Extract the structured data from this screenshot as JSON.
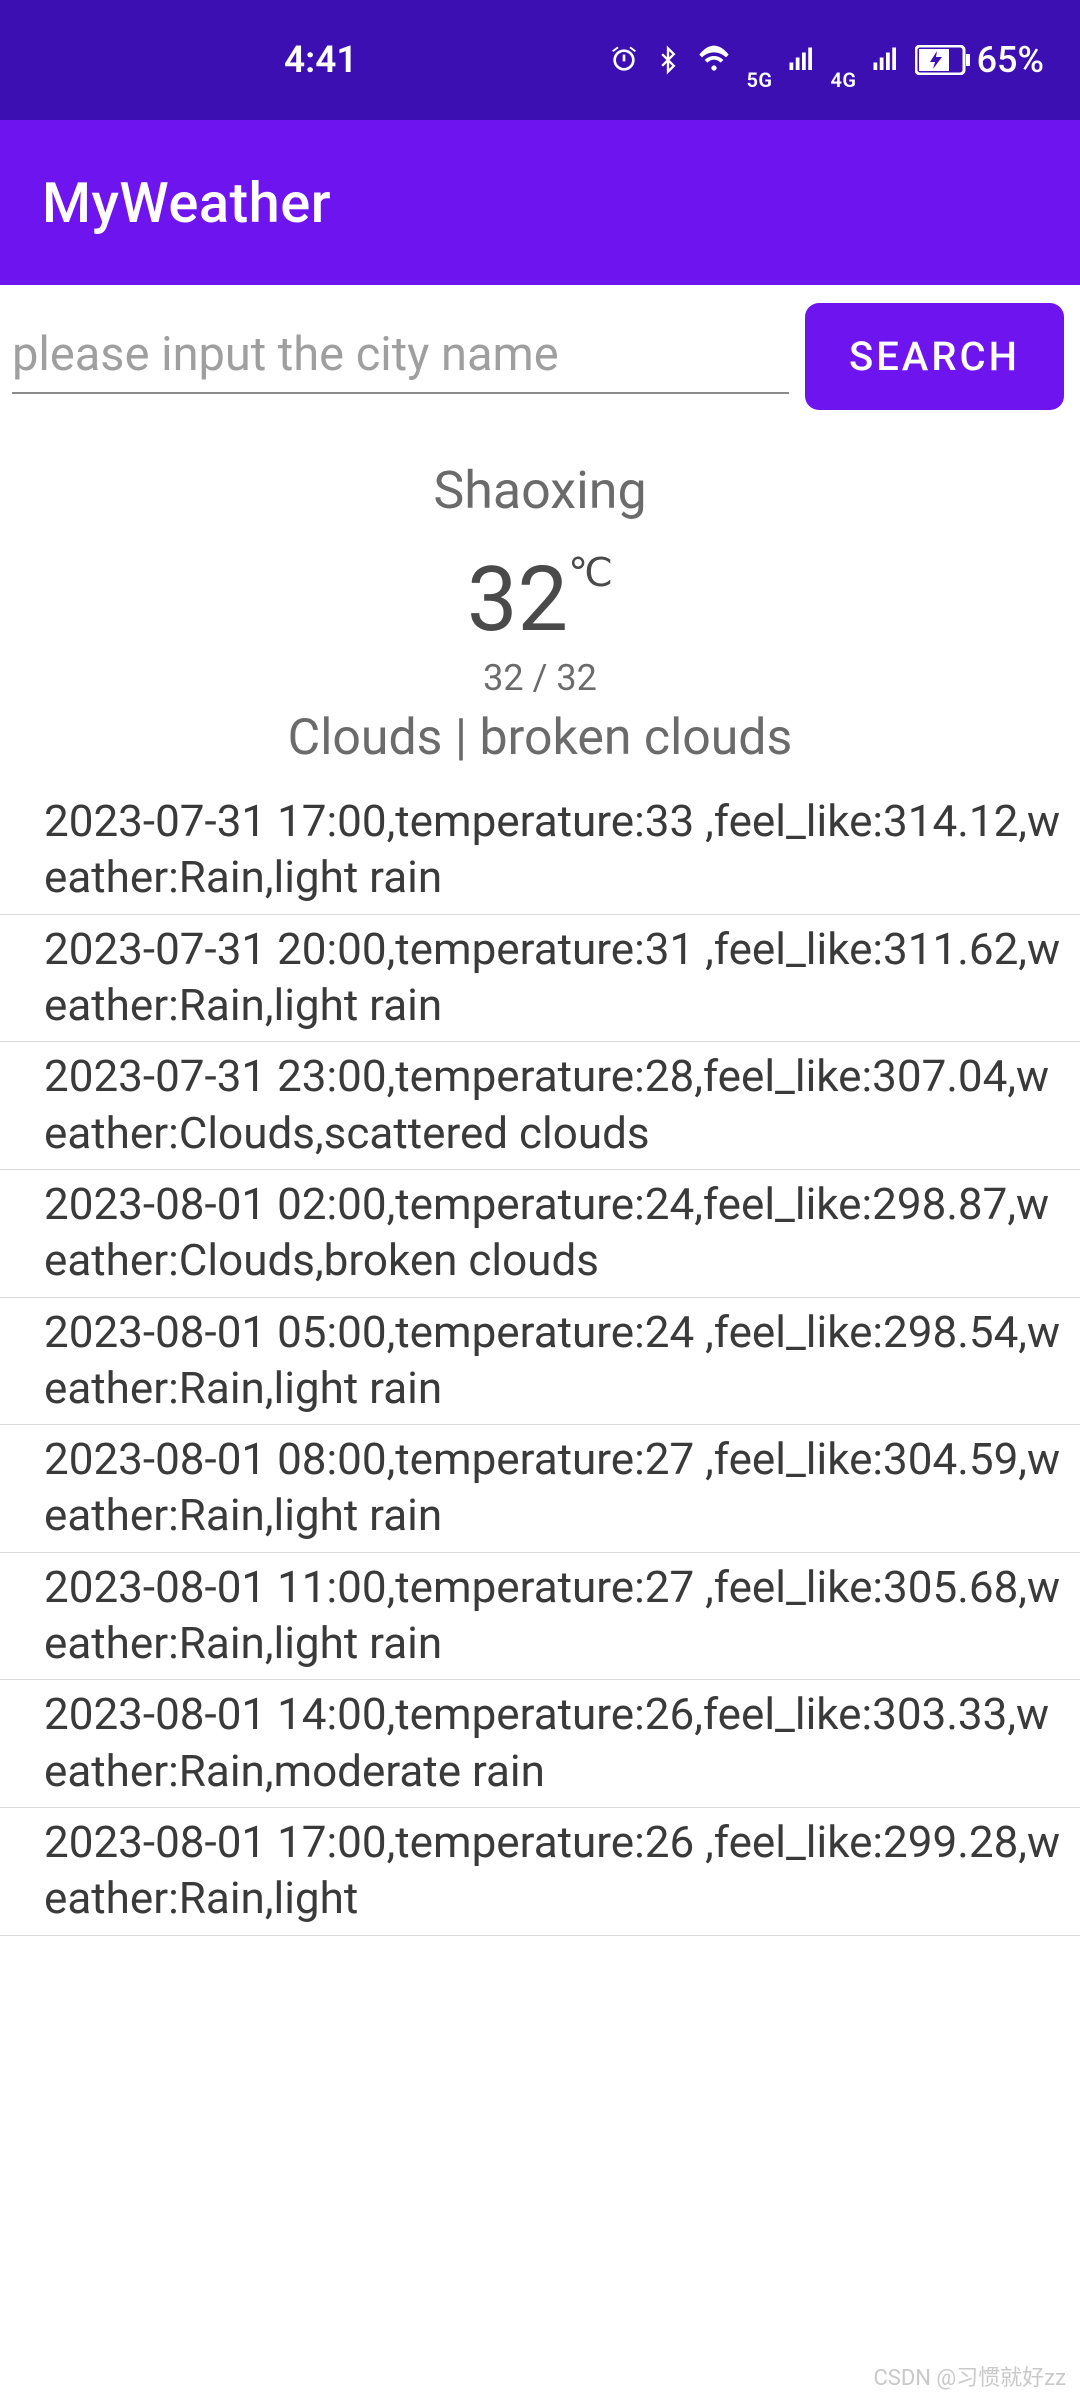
{
  "status": {
    "time": "4:41",
    "net1": "5G",
    "net2": "4G",
    "battery": "65%"
  },
  "app": {
    "title": "MyWeather"
  },
  "search": {
    "placeholder": "please input the city name",
    "button_label": "SEARCH",
    "value": ""
  },
  "current": {
    "city": "Shaoxing",
    "temp": "32",
    "unit": "℃",
    "range": "32 / 32",
    "condition": "Clouds | broken clouds"
  },
  "forecast": [
    "2023-07-31 17:00,temperature:33 ,feel_like:314.12,weather:Rain,light rain",
    "2023-07-31 20:00,temperature:31 ,feel_like:311.62,weather:Rain,light rain",
    "2023-07-31 23:00,temperature:28,feel_like:307.04,weather:Clouds,scattered clouds",
    "2023-08-01 02:00,temperature:24,feel_like:298.87,weather:Clouds,broken clouds",
    "2023-08-01 05:00,temperature:24 ,feel_like:298.54,weather:Rain,light rain",
    "2023-08-01 08:00,temperature:27 ,feel_like:304.59,weather:Rain,light rain",
    "2023-08-01 11:00,temperature:27 ,feel_like:305.68,weather:Rain,light rain",
    "2023-08-01 14:00,temperature:26,feel_like:303.33,weather:Rain,moderate rain",
    "2023-08-01 17:00,temperature:26 ,feel_like:299.28,weather:Rain,light"
  ],
  "watermark": "CSDN @习惯就好zz"
}
